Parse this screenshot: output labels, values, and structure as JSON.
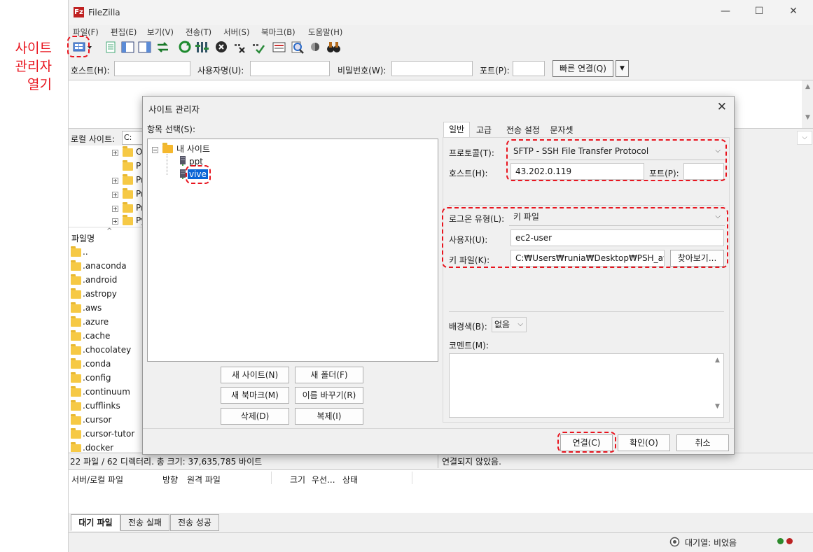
{
  "annotation": [
    "사이트",
    "관리자",
    "열기"
  ],
  "app": {
    "title": "FileZilla"
  },
  "window_controls": {
    "minimize": "—",
    "maximize": "☐",
    "close": "✕"
  },
  "menu": [
    "파일(F)",
    "편집(E)",
    "보기(V)",
    "전송(T)",
    "서버(S)",
    "북마크(B)",
    "도움말(H)"
  ],
  "quickconnect": {
    "host_label": "호스트(H):",
    "user_label": "사용자명(U):",
    "pass_label": "비밀번호(W):",
    "port_label": "포트(P):",
    "connect_btn": "빠른 연결(Q)",
    "dropdown": "▼"
  },
  "local": {
    "label": "로컬 사이트:",
    "path": "C:₩U",
    "tree_items": [
      "O",
      "P",
      "Pr",
      "Pr",
      "Pr",
      "Py"
    ],
    "files_header": "파일명",
    "files": [
      "..",
      ".anaconda",
      ".android",
      ".astropy",
      ".aws",
      ".azure",
      ".cache",
      ".chocolatey",
      ".conda",
      ".config",
      ".continuum",
      ".cufflinks",
      ".cursor",
      ".cursor-tutor",
      ".docker"
    ],
    "summary": "22 파일 / 62 디렉터리. 총 크기: 37,635,785 바이트"
  },
  "remote": {
    "status": "연결되지 않았음."
  },
  "queue": {
    "headers": [
      "서버/로컬 파일",
      "방향",
      "원격 파일",
      "크기",
      "우선...",
      "상태"
    ],
    "tabs": [
      "대기 파일",
      "전송 실패",
      "전송 성공"
    ],
    "status": "대기열: 비었음"
  },
  "dialog": {
    "title": "사이트 관리자",
    "close": "✕",
    "entry_label": "항목 선택(S):",
    "tree": {
      "root": "내 사이트",
      "sites": [
        "ppt",
        "vive"
      ]
    },
    "buttons": {
      "new_site": "새 사이트(N)",
      "new_folder": "새 폴더(F)",
      "new_bookmark": "새 북마크(M)",
      "rename": "이름 바꾸기(R)",
      "delete": "삭제(D)",
      "duplicate": "복제(I)",
      "connect": "연결(C)",
      "ok": "확인(O)",
      "cancel": "취소"
    },
    "tabs": [
      "일반",
      "고급",
      "전송 설정",
      "문자셋"
    ],
    "general": {
      "protocol_label": "프로토콜(T):",
      "protocol_value": "SFTP - SSH File Transfer Protocol",
      "host_label": "호스트(H):",
      "host_value": "43.202.0.119",
      "port_label": "포트(P):",
      "port_value": "",
      "logon_label": "로그온 유형(L):",
      "logon_value": "키 파일",
      "user_label": "사용자(U):",
      "user_value": "ec2-user",
      "keyfile_label": "키 파일(K):",
      "keyfile_value": "C:₩Users₩runia₩Desktop₩PSH_aws ₩",
      "browse_btn": "찾아보기...",
      "bg_label": "배경색(B):",
      "bg_value": "없음",
      "comment_label": "코멘트(M):"
    }
  }
}
